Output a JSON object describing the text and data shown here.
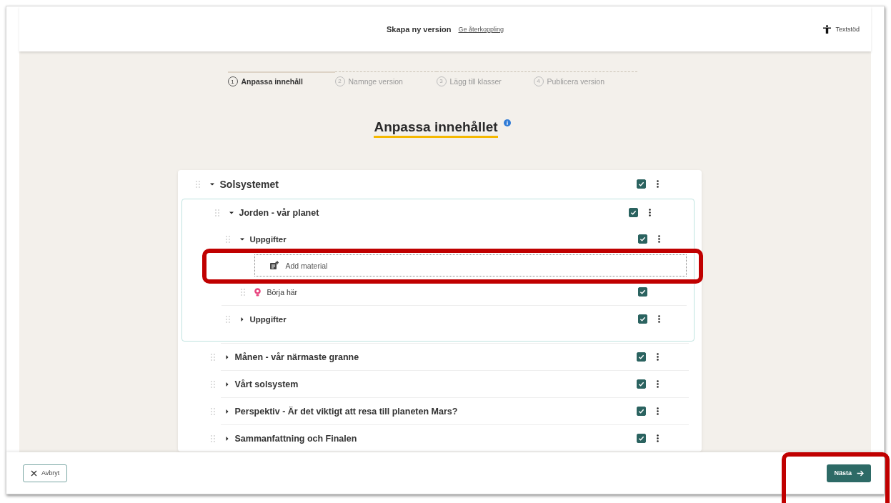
{
  "header": {
    "title": "Skapa ny version",
    "feedback_link": "Ge återkoppling",
    "text_support": "Textstöd"
  },
  "steps": [
    {
      "number": "1",
      "label": "Anpassa innehåll",
      "selected": true
    },
    {
      "number": "2",
      "label": "Namnge version",
      "selected": false
    },
    {
      "number": "3",
      "label": "Lägg till klasser",
      "selected": false
    },
    {
      "number": "4",
      "label": "Publicera version",
      "selected": false
    }
  ],
  "heading": "Anpassa innehållet",
  "tree": [
    {
      "kind": "section",
      "title": "Solsystemet",
      "expanded": true,
      "checked": true,
      "children": [
        {
          "kind": "section",
          "title": "Jorden - vår planet",
          "expanded": true,
          "checked": true,
          "focused": true,
          "children": [
            {
              "kind": "section",
              "title": "Uppgifter",
              "expanded": true,
              "checked": true,
              "children": [
                {
                  "kind": "add",
                  "title": "Add material",
                  "annotated": true
                },
                {
                  "kind": "material",
                  "title": "Börja här",
                  "checked": true
                }
              ]
            },
            {
              "kind": "section",
              "title": "Uppgifter",
              "expanded": false,
              "checked": true
            }
          ]
        },
        {
          "kind": "section",
          "title": "Månen - vår närmaste granne",
          "expanded": false,
          "checked": true
        },
        {
          "kind": "section",
          "title": "Vårt solsystem",
          "expanded": false,
          "checked": true
        },
        {
          "kind": "section",
          "title": "Perspektiv - Är det viktigt att resa till planeten Mars?",
          "expanded": false,
          "checked": true
        },
        {
          "kind": "section",
          "title": "Sammanfattning och Finalen",
          "expanded": false,
          "checked": true
        }
      ]
    }
  ],
  "footer": {
    "cancel": "Avbryt",
    "next": {
      "label": "Nästa",
      "annotated": true
    }
  }
}
